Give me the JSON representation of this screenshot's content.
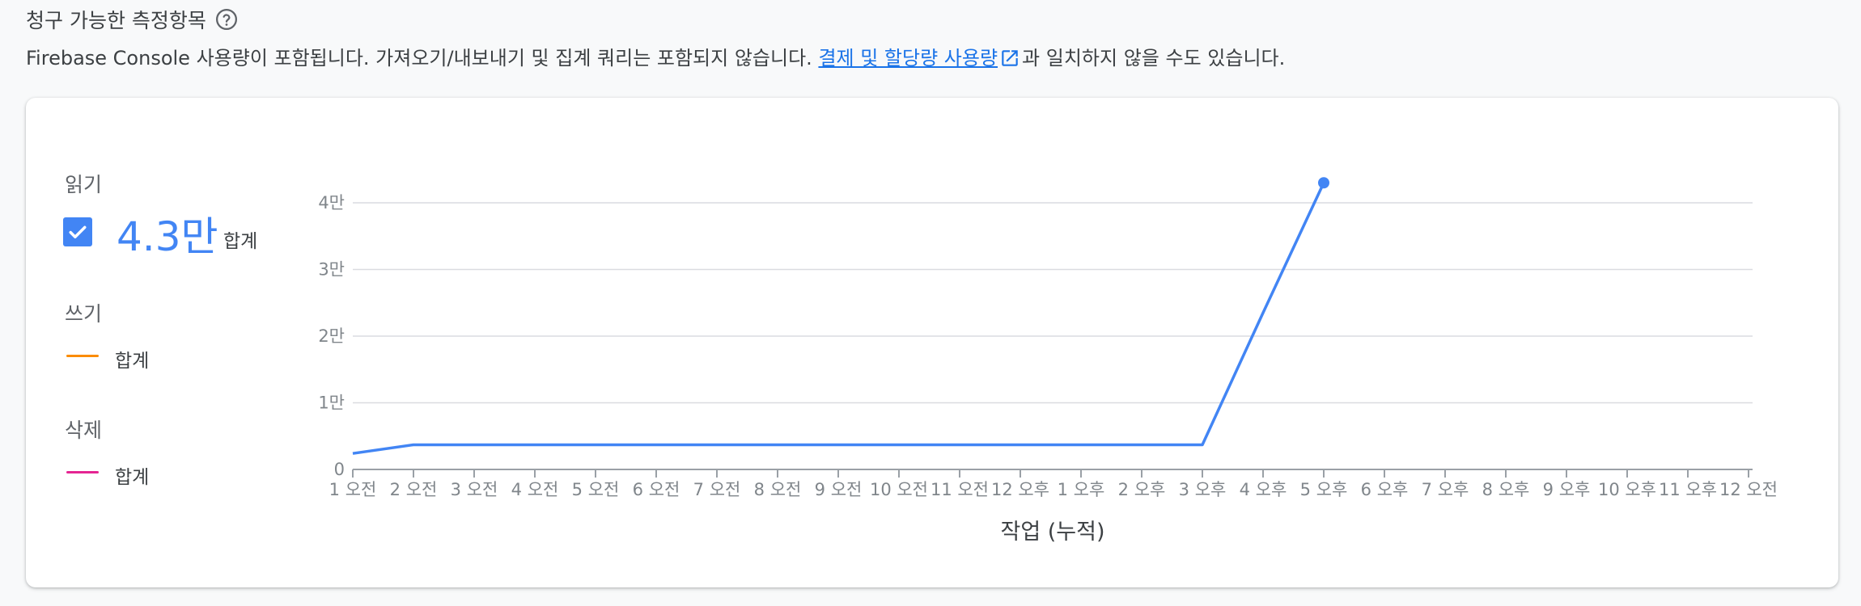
{
  "header": {
    "title": "청구 가능한 측정항목",
    "help_icon": "help-circle-icon"
  },
  "description": {
    "text_before": "Firebase Console 사용량이 포함됩니다. 가져오기/내보내기 및 집계 쿼리는 포함되지 않습니다. ",
    "link_text": "결제 및 할당량 사용량",
    "link_icon": "open-in-new-icon",
    "text_after": "과 일치하지 않을 수도 있습니다."
  },
  "legend": {
    "reads": {
      "label": "읽기",
      "value": "4.3만",
      "sum_label": "합계",
      "color": "#4285f4",
      "checked": true
    },
    "writes": {
      "label": "쓰기",
      "sum_label": "합계",
      "color": "#fb8c00"
    },
    "deletes": {
      "label": "삭제",
      "sum_label": "합계",
      "color": "#e52592"
    }
  },
  "chart_data": {
    "type": "line",
    "xlabel": "작업 (누적)",
    "ylabel": "",
    "x": [
      "1 오전",
      "2 오전",
      "3 오전",
      "4 오전",
      "5 오전",
      "6 오전",
      "7 오전",
      "8 오전",
      "9 오전",
      "10 오전",
      "11 오전",
      "12 오후",
      "1 오후",
      "2 오후",
      "3 오후",
      "4 오후",
      "5 오후",
      "6 오후",
      "7 오후",
      "8 오후",
      "9 오후",
      "10 오후",
      "11 오후",
      "12 오전"
    ],
    "ylim": [
      0,
      40000
    ],
    "yticks": [
      0,
      10000,
      20000,
      30000,
      40000
    ],
    "ytick_labels": [
      "0",
      "1만",
      "2만",
      "3만",
      "4만"
    ],
    "grid": true,
    "series": [
      {
        "name": "읽기",
        "color": "#4285f4",
        "values": [
          2400,
          3700,
          3700,
          3700,
          3700,
          3700,
          3700,
          3700,
          3700,
          3700,
          3700,
          3700,
          3700,
          3700,
          3700,
          23500,
          43000,
          null,
          null,
          null,
          null,
          null,
          null,
          null
        ]
      }
    ]
  }
}
